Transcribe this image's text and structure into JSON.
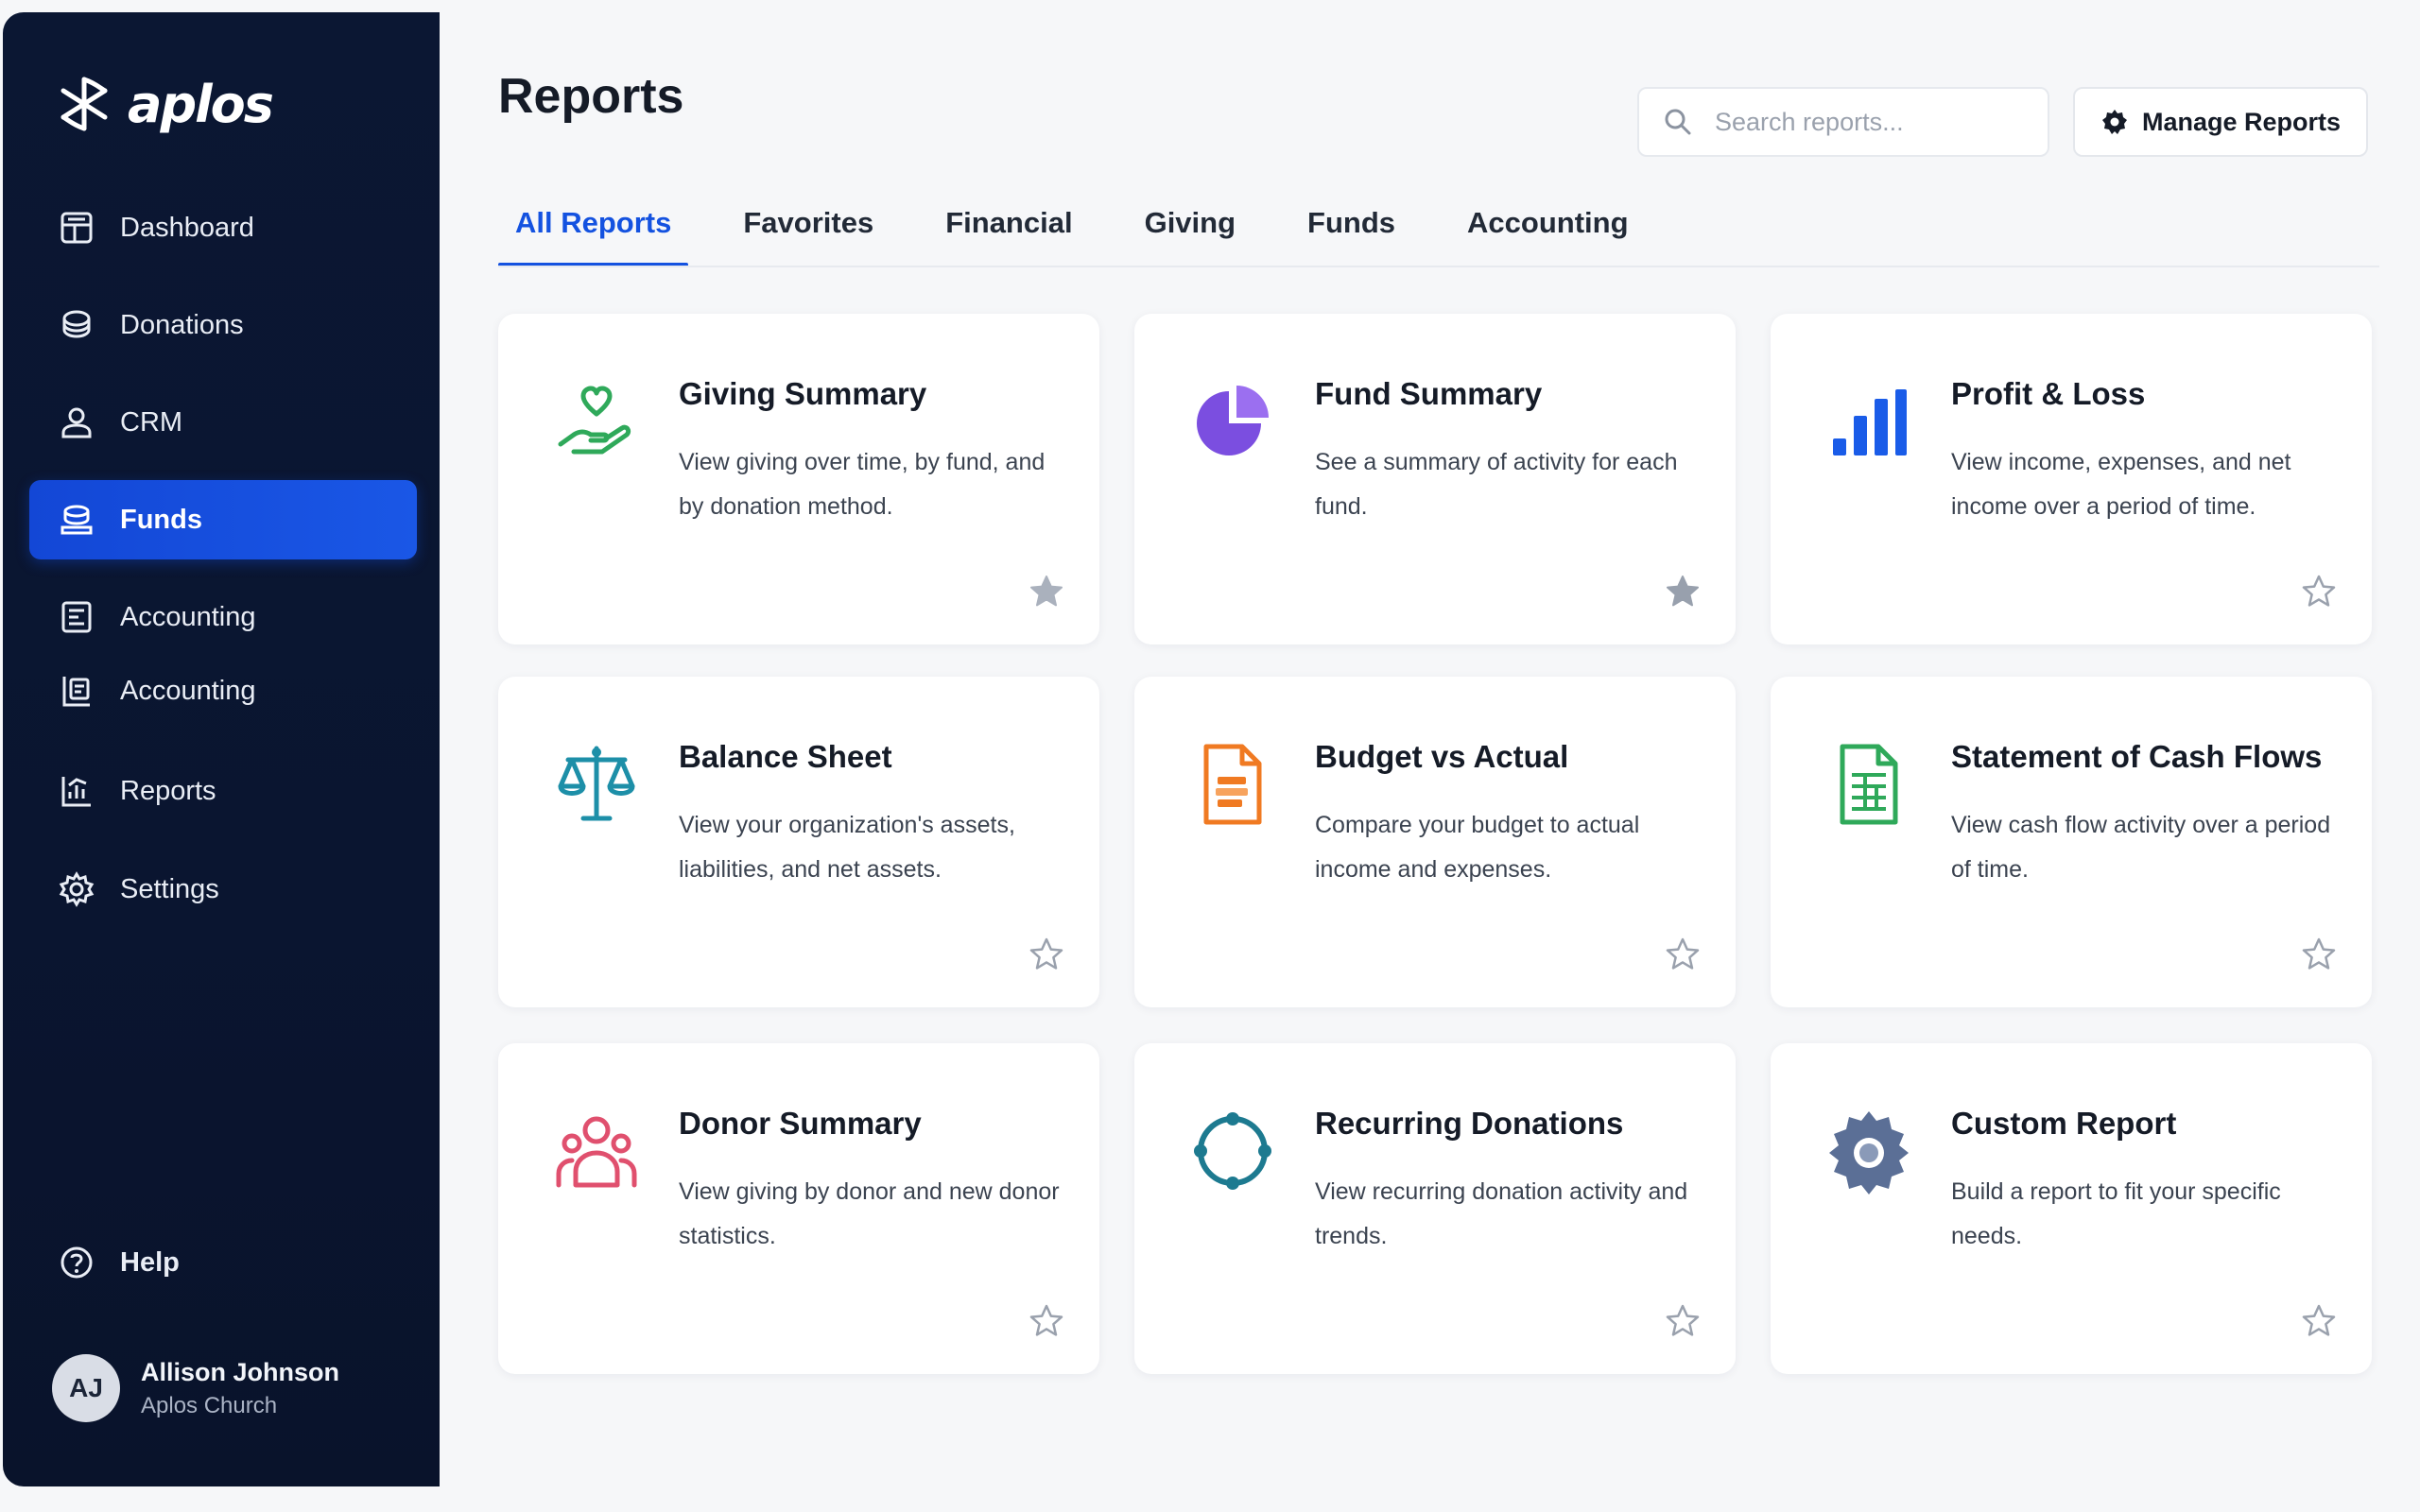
{
  "app": {
    "brand": "aplos"
  },
  "sidebar": {
    "items": [
      {
        "label": "Dashboard",
        "icon": "dashboard-icon"
      },
      {
        "label": "Donations",
        "icon": "donations-icon"
      },
      {
        "label": "CRM",
        "icon": "person-icon"
      },
      {
        "label": "Funds",
        "icon": "funds-icon",
        "active": true
      },
      {
        "label": "Accounting",
        "icon": "accounting-icon"
      },
      {
        "label": "Accounting",
        "icon": "ledger-icon"
      },
      {
        "label": "Reports",
        "icon": "reports-icon"
      },
      {
        "label": "Settings",
        "icon": "gear-icon"
      }
    ],
    "help": {
      "label": "Help",
      "icon": "help-icon"
    },
    "user": {
      "initials": "AJ",
      "name": "Allison Johnson",
      "org": "Aplos Church"
    }
  },
  "header": {
    "title": "Reports",
    "search": {
      "placeholder": "Search reports...",
      "value": ""
    },
    "manage_label": "Manage Reports"
  },
  "tabs": [
    {
      "label": "All Reports",
      "active": true
    },
    {
      "label": "Favorites"
    },
    {
      "label": "Financial"
    },
    {
      "label": "Giving"
    },
    {
      "label": "Funds"
    },
    {
      "label": "Accounting"
    }
  ],
  "cards": [
    {
      "title": "Giving Summary",
      "desc": "View giving over time, by fund, and by donation method.",
      "icon": "giving-hand-heart-icon",
      "favorite": false
    },
    {
      "title": "Fund Summary",
      "desc": "See a summary of activity for each fund.",
      "icon": "pie-chart-icon",
      "favorite": true
    },
    {
      "title": "Profit & Loss",
      "desc": "View income, expenses, and net income over a period of time.",
      "icon": "bar-chart-icon",
      "favorite": false
    },
    {
      "title": "Balance Sheet",
      "desc": "View your organization's assets, liabilities, and net assets.",
      "icon": "scale-icon",
      "favorite": false
    },
    {
      "title": "Budget vs Actual",
      "desc": "Compare your budget to actual income and expenses.",
      "icon": "budget-document-icon",
      "favorite": false
    },
    {
      "title": "Statement of Cash Flows",
      "desc": "View cash flow activity over a period of time.",
      "icon": "spreadsheet-document-icon",
      "favorite": false
    },
    {
      "title": "Donor Summary",
      "desc": "View giving by donor and new donor statistics.",
      "icon": "donor-group-icon",
      "favorite": false
    },
    {
      "title": "Recurring Donations",
      "desc": "View recurring donation activity and trends.",
      "icon": "recurring-cycle-icon",
      "favorite": false
    },
    {
      "title": "Custom Report",
      "desc": "Build a report to fit your specific needs.",
      "icon": "gear-icon",
      "favorite": false
    }
  ],
  "colors": {
    "sidebar_bg": "#0b1733",
    "accent": "#1452e0",
    "green": "#2fa95a",
    "purple": "#7b4ee0",
    "blue": "#1a5ce8",
    "teal": "#1d8fa8",
    "orange": "#f07a22",
    "pink": "#e0506e",
    "slate": "#5b6f96"
  }
}
